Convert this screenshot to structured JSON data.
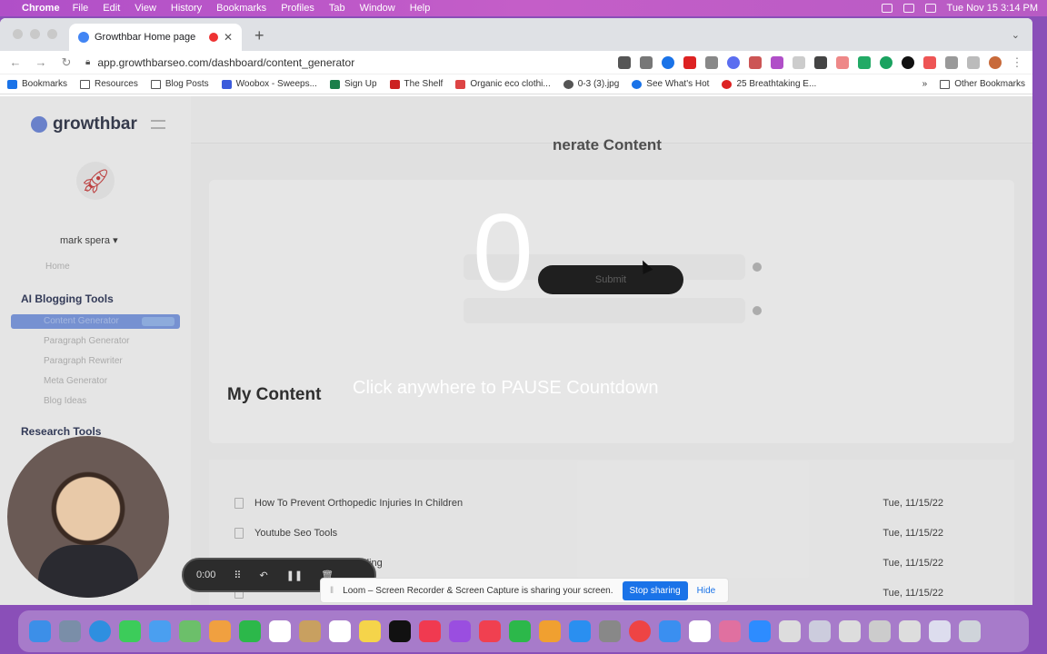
{
  "menubar": {
    "app": "Chrome",
    "items": [
      "File",
      "Edit",
      "View",
      "History",
      "Bookmarks",
      "Profiles",
      "Tab",
      "Window",
      "Help"
    ],
    "clock": "Tue Nov 15  3:14 PM"
  },
  "browser": {
    "tab_title": "Growthbar Home page",
    "url": "app.growthbarseo.com/dashboard/content_generator",
    "bookmarks": [
      "Bookmarks",
      "Resources",
      "Blog Posts",
      "Woobox - Sweeps...",
      "Sign Up",
      "The Shelf",
      "Organic eco clothi...",
      "0-3 (3).jpg",
      "See What's Hot",
      "25 Breathtaking E..."
    ],
    "other_bookmarks": "Other Bookmarks"
  },
  "app": {
    "logo": "growthbar",
    "user": "mark spera",
    "nav": {
      "home": "Home",
      "ai_section": "AI Blogging Tools",
      "ai_items": [
        "Content Generator",
        "Paragraph Generator",
        "Paragraph Rewriter",
        "Meta Generator",
        "Blog Ideas"
      ],
      "research_section": "Research Tools"
    },
    "generator": {
      "title": "nerate Content",
      "submit": "Submit"
    },
    "my_content": {
      "title": "My Content",
      "rows": [
        {
          "title": "How To Prevent Orthopedic Injuries In Children",
          "date": "Tue, 11/15/22"
        },
        {
          "title": "Youtube Seo Tools",
          "date": "Tue, 11/15/22"
        },
        {
          "title": "ding",
          "date": "Tue, 11/15/22"
        },
        {
          "title": "",
          "date": "Tue, 11/15/22"
        }
      ]
    }
  },
  "overlay": {
    "countdown": "0",
    "message": "Click anywhere to PAUSE Countdown"
  },
  "loom": {
    "timer": "0:00",
    "sharing_message": "Loom – Screen Recorder & Screen Capture is sharing your screen.",
    "stop_button": "Stop sharing",
    "hide_button": "Hide"
  },
  "colors": {
    "menubar_bg": "#b04fc8",
    "accent": "#1a73e8",
    "sidebar_active": "#6d8fe0"
  }
}
